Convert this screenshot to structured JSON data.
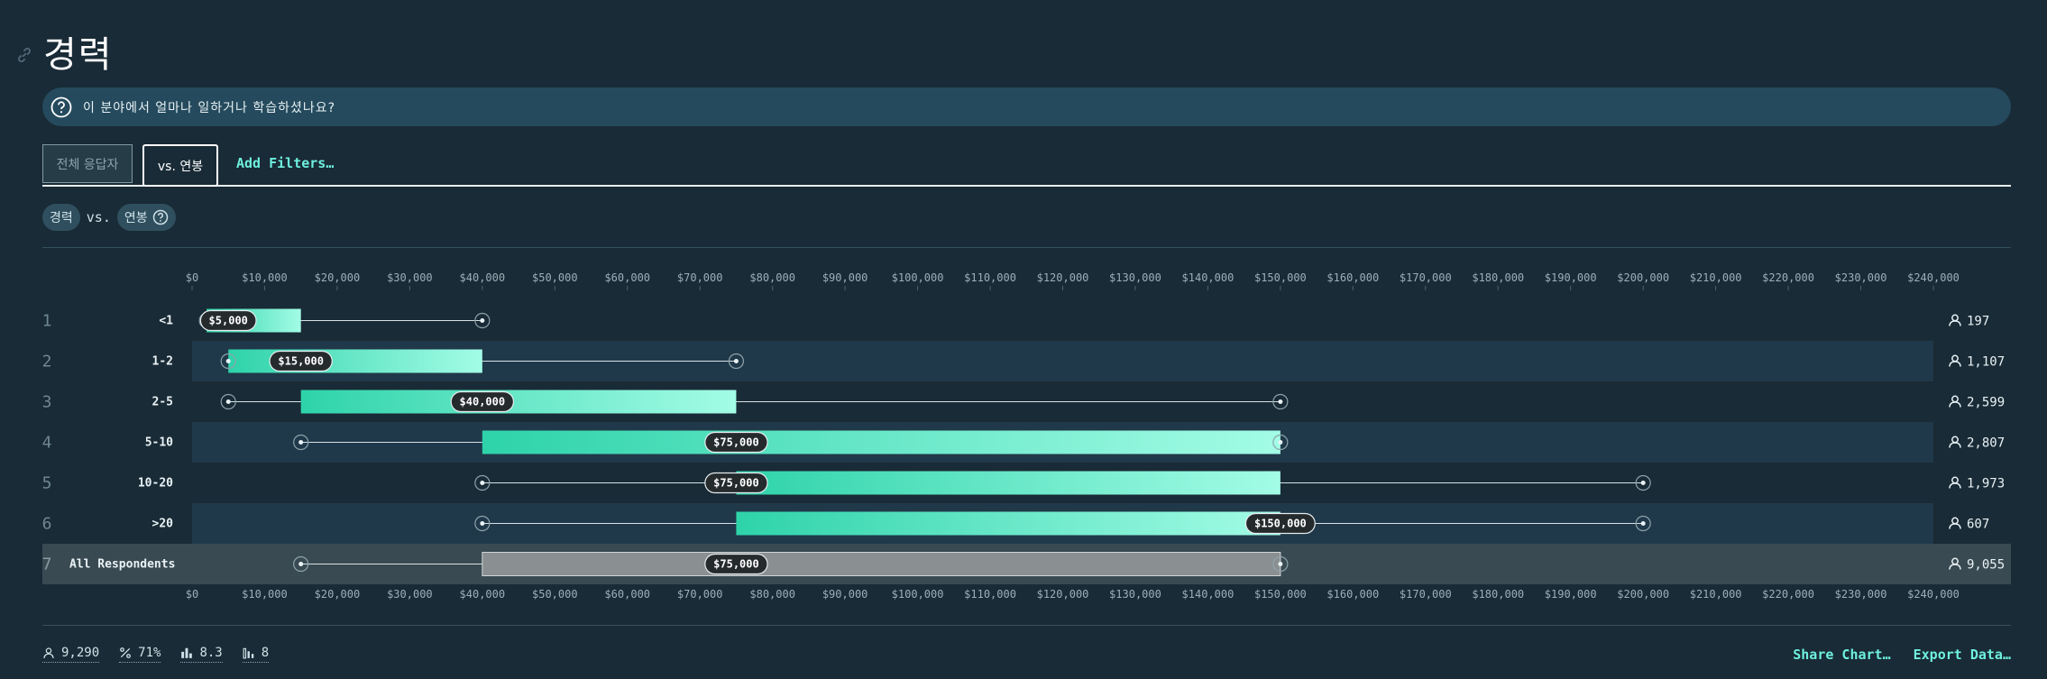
{
  "page": {
    "title": "경력"
  },
  "question": {
    "text": "이 분야에서 얼마나 일하거나 학습하셨나요?"
  },
  "tabs": {
    "all_respondents": "전체 응답자",
    "vs_salary": "vs. 연봉",
    "add_filters": "Add Filters…"
  },
  "comparison": {
    "left": "경력",
    "vs": "vs.",
    "right": "연봉"
  },
  "chart_data": {
    "type": "boxplot",
    "xlim": [
      0,
      240000
    ],
    "ticks": [
      0,
      10000,
      20000,
      30000,
      40000,
      50000,
      60000,
      70000,
      80000,
      90000,
      100000,
      110000,
      120000,
      130000,
      140000,
      150000,
      160000,
      170000,
      180000,
      190000,
      200000,
      210000,
      220000,
      230000,
      240000
    ],
    "tick_labels": [
      "$0",
      "$10,000",
      "$20,000",
      "$30,000",
      "$40,000",
      "$50,000",
      "$60,000",
      "$70,000",
      "$80,000",
      "$90,000",
      "$100,000",
      "$110,000",
      "$120,000",
      "$130,000",
      "$140,000",
      "$150,000",
      "$160,000",
      "$170,000",
      "$180,000",
      "$190,000",
      "$200,000",
      "$210,000",
      "$220,000",
      "$230,000",
      "$240,000"
    ],
    "rows": [
      {
        "index": "1",
        "label": "<1",
        "min": 2000,
        "q1": 2000,
        "median": 5000,
        "median_label": "$5,000",
        "q3": 15000,
        "max": 40000,
        "count": "197"
      },
      {
        "index": "2",
        "label": "1-2",
        "min": 5000,
        "q1": 5000,
        "median": 15000,
        "median_label": "$15,000",
        "q3": 40000,
        "max": 75000,
        "count": "1,107"
      },
      {
        "index": "3",
        "label": "2-5",
        "min": 5000,
        "q1": 15000,
        "median": 40000,
        "median_label": "$40,000",
        "q3": 75000,
        "max": 150000,
        "count": "2,599"
      },
      {
        "index": "4",
        "label": "5-10",
        "min": 15000,
        "q1": 40000,
        "median": 75000,
        "median_label": "$75,000",
        "q3": 150000,
        "max": 150000,
        "count": "2,807"
      },
      {
        "index": "5",
        "label": "10-20",
        "min": 40000,
        "q1": 75000,
        "median": 75000,
        "median_label": "$75,000",
        "q3": 150000,
        "max": 200000,
        "count": "1,973"
      },
      {
        "index": "6",
        "label": ">20",
        "min": 40000,
        "q1": 75000,
        "median": 150000,
        "median_label": "$150,000",
        "q3": 150000,
        "max": 200000,
        "count": "607"
      },
      {
        "index": "7",
        "label": "All Respondents",
        "min": 15000,
        "q1": 40000,
        "median": 75000,
        "median_label": "$75,000",
        "q3": 150000,
        "max": 150000,
        "count": "9,055",
        "overall": true
      }
    ],
    "colors": {
      "bar_start": "#2ed3aa",
      "bar_end": "#a3fce6",
      "overall_bar": "#8a8f91"
    }
  },
  "footer": {
    "respondents": "9,290",
    "percent": "71%",
    "mean": "8.3",
    "count": "8",
    "share": "Share Chart…",
    "export": "Export Data…"
  }
}
